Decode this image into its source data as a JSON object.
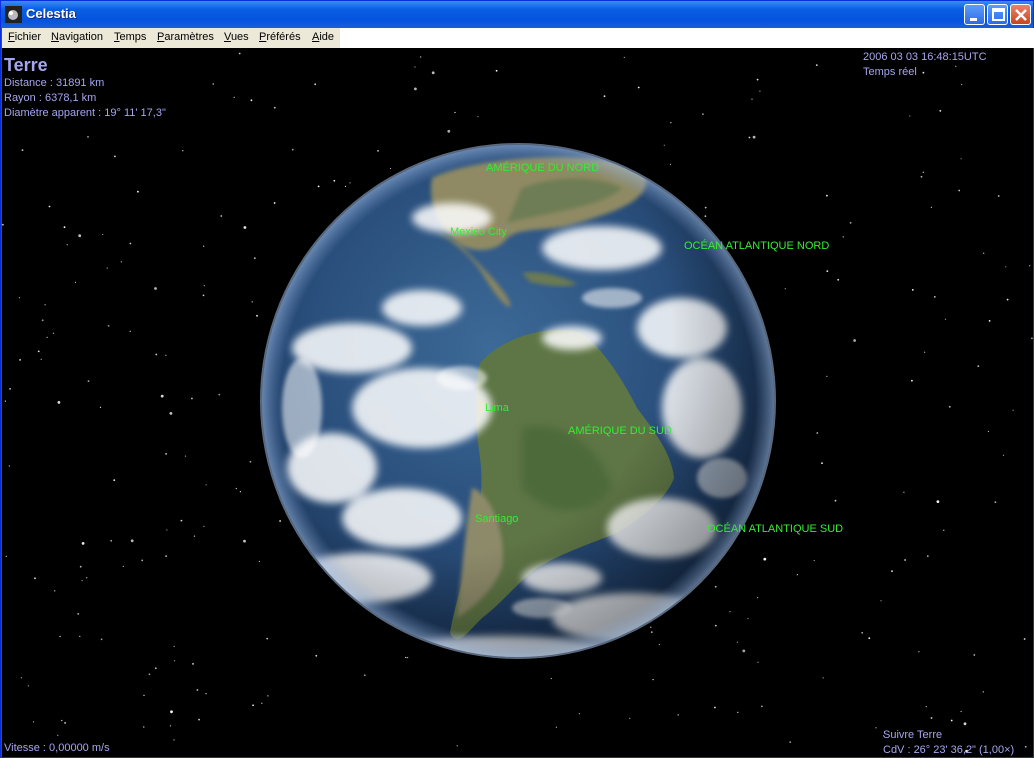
{
  "window": {
    "title": "Celestia",
    "buttons": {
      "minimize": "minimize",
      "maximize": "maximize",
      "close": "close"
    }
  },
  "menu": {
    "items": [
      "Fichier",
      "Navigation",
      "Temps",
      "Paramètres",
      "Vues",
      "Préférés",
      "Aide"
    ]
  },
  "info": {
    "object_name": "Terre",
    "distance": "Distance : 31891 km",
    "radius": "Rayon : 6378,1 km",
    "apparent_diameter": "Diamètre apparent : 19° 11' 17,3\""
  },
  "time": {
    "datetime": "2006 03 03 16:48:15UTC",
    "mode": "Temps réel"
  },
  "status": {
    "speed": "Vitesse : 0,00000 m/s",
    "follow": "Suivre Terre",
    "fov": "CdV : 26° 23' 36,2\" (1,00×)"
  },
  "labels": {
    "north_america": "AMÉRIQUE DU NORD",
    "mexico_city": "Mexico City",
    "north_atlantic": "OCÉAN ATLANTIQUE NORD",
    "lima": "Lima",
    "south_america": "AMÉRIQUE DU SUD",
    "santiago": "Santiago",
    "south_atlantic": "OCÉAN ATLANTIQUE SUD"
  },
  "colors": {
    "hud_text": "#a6a6ee",
    "label_text": "#33ee33",
    "space": "#000000"
  }
}
